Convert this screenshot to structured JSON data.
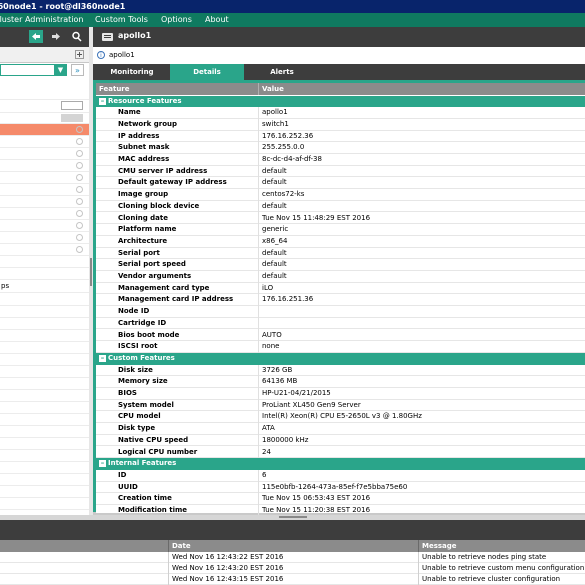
{
  "window": {
    "title": "360node1 - root@dl360node1"
  },
  "menu": {
    "items": [
      {
        "label": "Cluster Administration"
      },
      {
        "label": "Custom Tools"
      },
      {
        "label": "Options"
      },
      {
        "label": "About"
      }
    ]
  },
  "left_panel": {
    "toolbar_icons": [
      "back-arrow-icon",
      "forward-arrow-icon",
      "search-icon"
    ],
    "visible_item_fragment": "ps"
  },
  "right_panel": {
    "node_name": "apollo1",
    "breadcrumb": "apollo1",
    "tabs": [
      {
        "label": "Monitoring"
      },
      {
        "label": "Details",
        "active": true
      },
      {
        "label": "Alerts"
      }
    ],
    "columns": {
      "feature": "Feature",
      "value": "Value"
    },
    "sections": {
      "resource": "Resource Features",
      "custom": "Custom Features",
      "internal": "Internal Features"
    },
    "resource_rows": [
      {
        "f": "Name",
        "v": "apollo1"
      },
      {
        "f": "Network group",
        "v": "switch1"
      },
      {
        "f": "IP address",
        "v": "176.16.252.36"
      },
      {
        "f": "Subnet mask",
        "v": "255.255.0.0"
      },
      {
        "f": "MAC address",
        "v": "8c-dc-d4-af-df-38"
      },
      {
        "f": "CMU server IP address",
        "v": "default"
      },
      {
        "f": "Default gateway IP address",
        "v": "default"
      },
      {
        "f": "Image group",
        "v": "centos72-ks"
      },
      {
        "f": "Cloning block device",
        "v": "default"
      },
      {
        "f": "Cloning date",
        "v": "Tue Nov 15 11:48:29 EST 2016"
      },
      {
        "f": "Platform name",
        "v": "generic"
      },
      {
        "f": "Architecture",
        "v": "x86_64"
      },
      {
        "f": "Serial port",
        "v": "default"
      },
      {
        "f": "Serial port speed",
        "v": "default"
      },
      {
        "f": "Vendor arguments",
        "v": "default"
      },
      {
        "f": "Management card type",
        "v": "iLO"
      },
      {
        "f": "Management card IP address",
        "v": "176.16.251.36"
      },
      {
        "f": "Node ID",
        "v": ""
      },
      {
        "f": "Cartridge ID",
        "v": ""
      },
      {
        "f": "Bios boot mode",
        "v": "AUTO"
      },
      {
        "f": "ISCSI root",
        "v": "none"
      }
    ],
    "custom_rows": [
      {
        "f": "Disk size",
        "v": "3726 GB"
      },
      {
        "f": "Memory size",
        "v": "64136 MB"
      },
      {
        "f": "BIOS",
        "v": "HP-U21-04/21/2015"
      },
      {
        "f": "System model",
        "v": "ProLiant XL450 Gen9 Server"
      },
      {
        "f": "CPU model",
        "v": "Intel(R) Xeon(R) CPU E5-2650L v3 @ 1.80GHz"
      },
      {
        "f": "Disk type",
        "v": "ATA"
      },
      {
        "f": "Native CPU speed",
        "v": "1800000 kHz"
      },
      {
        "f": "Logical CPU number",
        "v": "24"
      }
    ],
    "internal_rows": [
      {
        "f": "ID",
        "v": "6"
      },
      {
        "f": "UUID",
        "v": "115e0bfb-1264-473a-85ef-f7e5bba75e60"
      },
      {
        "f": "Creation time",
        "v": "Tue Nov 15 06:53:43 EST 2016"
      },
      {
        "f": "Modification time",
        "v": "Tue Nov 15 11:20:38 EST 2016"
      }
    ]
  },
  "log": {
    "columns": {
      "date": "Date",
      "message": "Message"
    },
    "rows": [
      {
        "date": "Wed Nov 16 12:43:22 EST 2016",
        "message": "Unable to retrieve nodes ping state"
      },
      {
        "date": "Wed Nov 16 12:43:20 EST 2016",
        "message": "Unable to retrieve custom menu configuration"
      },
      {
        "date": "Wed Nov 16 12:43:15 EST 2016",
        "message": "Unable to retrieve cluster configuration"
      }
    ]
  },
  "colors": {
    "accent": "#2aa58a",
    "titlebar": "#08246b",
    "menubar": "#0f7a60",
    "highlight_row": "#f58a6a"
  }
}
